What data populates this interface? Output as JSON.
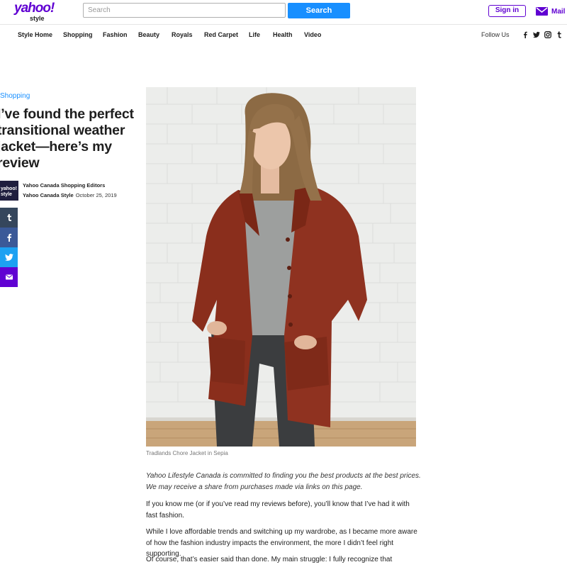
{
  "header": {
    "logo_main": "yahoo!",
    "logo_sub": "style",
    "search_placeholder": "Search",
    "search_button": "Search",
    "signin_label": "Sign in",
    "mail_label": "Mail"
  },
  "nav": {
    "items": [
      "Style Home",
      "Shopping",
      "Fashion",
      "Beauty",
      "Royals",
      "Red Carpet",
      "Life",
      "Health",
      "Video"
    ],
    "follow_label": "Follow Us",
    "social_icons": [
      "facebook-icon",
      "twitter-icon",
      "instagram-icon",
      "tumblr-icon"
    ]
  },
  "article": {
    "category": "Shopping",
    "headline": "I’ve found the perfect transitional weather jacket—here’s my review",
    "avatar_text": "yahoo! style",
    "author": "Yahoo Canada Shopping Editors",
    "source": "Yahoo Canada Style",
    "date": "October 25, 2019",
    "share_icons": [
      "tumblr-icon",
      "facebook-icon",
      "twitter-icon",
      "mail-icon"
    ],
    "caption": "Tradlands Chore Jacket in Sepia",
    "disclaimer": "Yahoo Lifestyle Canada is committed to finding you the best products at the best prices. We may receive a share from purchases made via links on this page.",
    "paragraphs": [
      "If you know me (or if you’ve read my reviews before), you’ll know that I’ve had it with fast fashion.",
      "While I love affordable trends and switching up my wardrobe, as I became more aware of how the fashion industry impacts the environment, the more I didn’t feel right supporting.",
      "Of course, that’s easier said than done. My main struggle: I fully recognize that"
    ]
  },
  "colors": {
    "brand_purple": "#6001d2",
    "search_blue": "#188fff",
    "tumblr": "#35465c",
    "facebook": "#3b5998",
    "twitter": "#1da1f2",
    "mail": "#6001d2"
  }
}
